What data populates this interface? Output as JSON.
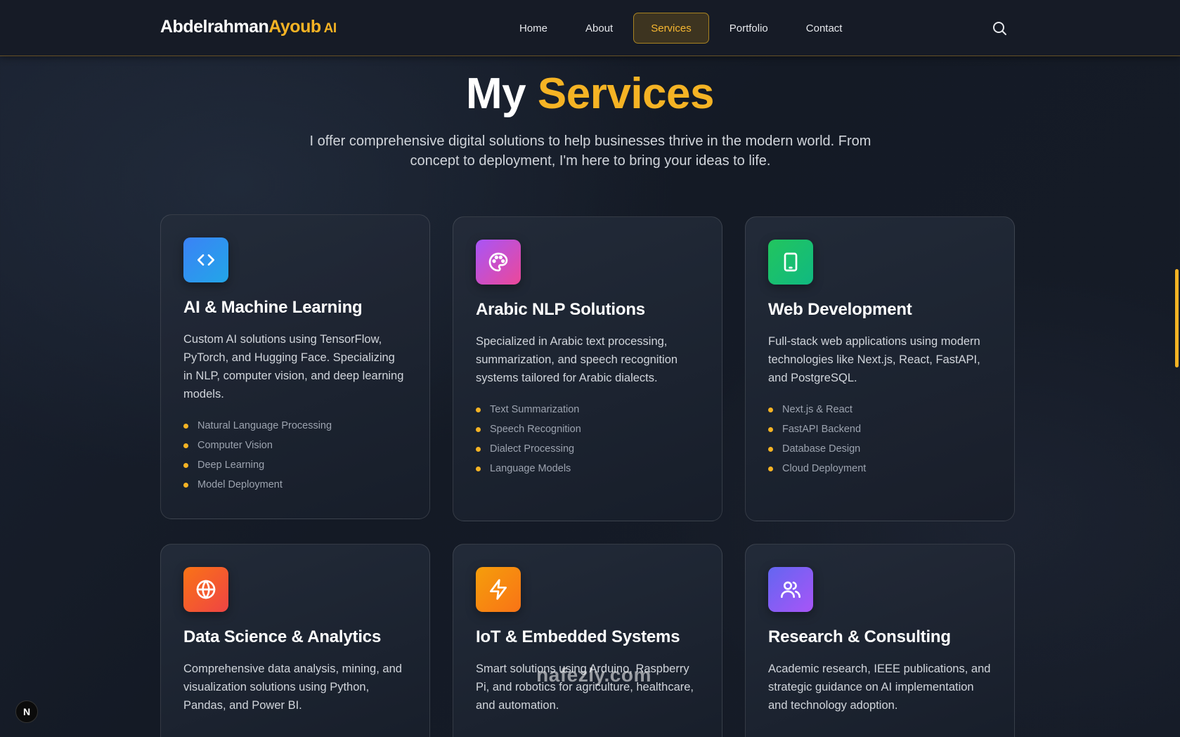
{
  "header": {
    "logo_first": "Abdelrahman",
    "logo_second": "Ayoub",
    "logo_suffix": "AI",
    "nav": [
      {
        "label": "Home"
      },
      {
        "label": "About"
      },
      {
        "label": "Services",
        "active": true
      },
      {
        "label": "Portfolio"
      },
      {
        "label": "Contact"
      }
    ],
    "search_icon": "search-icon"
  },
  "hero": {
    "title_prefix": "My",
    "title_accent": "Services",
    "subtitle": "I offer comprehensive digital solutions to help businesses thrive in the modern world. From concept to deployment, I'm here to bring your ideas to life."
  },
  "services": [
    {
      "icon": "code-icon",
      "color": "#2f8ff0",
      "title": "AI & Machine Learning",
      "description": "Custom AI solutions using TensorFlow, PyTorch, and Hugging Face. Specializing in NLP, computer vision, and deep learning models.",
      "features": [
        "Natural Language Processing",
        "Computer Vision",
        "Deep Learning",
        "Model Deployment"
      ]
    },
    {
      "icon": "palette-icon",
      "color": "#c04be6",
      "title": "Arabic NLP Solutions",
      "description": "Specialized in Arabic text processing, summarization, and speech recognition systems tailored for Arabic dialects.",
      "features": [
        "Text Summarization",
        "Speech Recognition",
        "Dialect Processing",
        "Language Models"
      ]
    },
    {
      "icon": "tablet-icon",
      "color": "#22c06a",
      "title": "Web Development",
      "description": "Full-stack web applications using modern technologies like Next.js, React, FastAPI, and PostgreSQL.",
      "features": [
        "Next.js & React",
        "FastAPI Backend",
        "Database Design",
        "Cloud Deployment"
      ]
    },
    {
      "icon": "globe-icon",
      "color": "#f2562a",
      "title": "Data Science & Analytics",
      "description": "Comprehensive data analysis, mining, and visualization solutions using Python, Pandas, and Power BI.",
      "features": []
    },
    {
      "icon": "lightning-icon",
      "color": "#f99a12",
      "title": "IoT & Embedded Systems",
      "description": "Smart solutions using Arduino, Raspberry Pi, and robotics for agriculture, healthcare, and automation.",
      "features": []
    },
    {
      "icon": "users-icon",
      "color": "#8a5cf0",
      "title": "Research & Consulting",
      "description": "Academic research, IEEE publications, and strategic guidance on AI implementation and technology adoption.",
      "features": []
    }
  ],
  "badge": "N",
  "watermark": "nafezly.com"
}
